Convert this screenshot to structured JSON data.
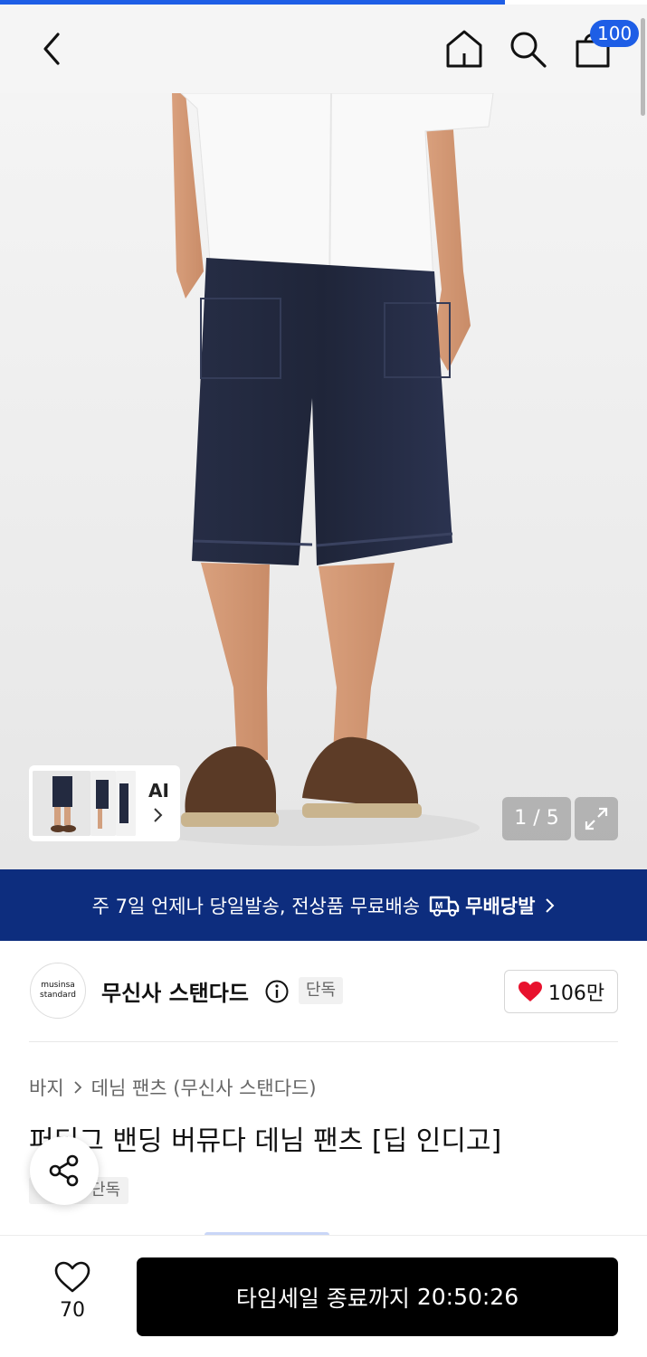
{
  "header": {
    "back": "chevron-left-icon",
    "home": "home-icon",
    "search": "search-icon",
    "cart": "shopping-bag-icon",
    "cart_badge": "100"
  },
  "gallery": {
    "ai_label": "AI",
    "counter": "1 / 5",
    "expand": "expand-icon"
  },
  "banner": {
    "text": "주 7일 언제나 당일발송, 전상품 무료배송",
    "brand": "무배당발"
  },
  "store": {
    "logo_line1": "musinsa",
    "logo_line2": "standard",
    "name": "무신사 스탠다드",
    "tag": "단독",
    "likes": "106만"
  },
  "product": {
    "breadcrumb": [
      "바지",
      "데님 팬츠 (무신사 스탠다드)"
    ],
    "title": "퍼티그 밴딩 버뮤다 데님 팬츠 [딥 인디고]",
    "tag": "단독"
  },
  "bottom_bar": {
    "wish_count": "70",
    "cta_label": "타임세일 종료까지",
    "cta_time": "20:50:26"
  },
  "colors": {
    "accent": "#1e5ee6",
    "banner": "#0d2d7e",
    "heart": "#e8112d"
  }
}
